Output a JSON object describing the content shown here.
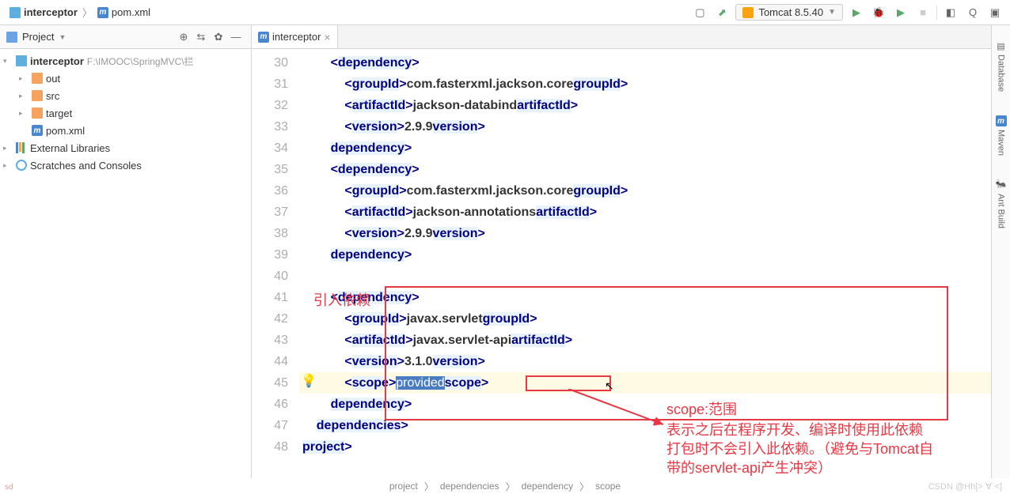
{
  "breadcrumb": {
    "project": "interceptor",
    "file": "pom.xml"
  },
  "runConfig": {
    "label": "Tomcat 8.5.40"
  },
  "projectPanel": {
    "title": "Project",
    "root": {
      "name": "interceptor",
      "path": "F:\\IMOOC\\SpringMVC\\拦"
    },
    "folders": [
      "out",
      "src",
      "target"
    ],
    "file": "pom.xml",
    "ext1": "External Libraries",
    "ext2": "Scratches and Consoles"
  },
  "tab": {
    "label": "interceptor"
  },
  "lines": [
    "30",
    "31",
    "32",
    "33",
    "34",
    "35",
    "36",
    "37",
    "38",
    "39",
    "40",
    "41",
    "42",
    "43",
    "44",
    "45",
    "46",
    "47",
    "48"
  ],
  "code": {
    "l30": {
      "pre": "        <",
      "t1": "dependency",
      "post": ">"
    },
    "l31": {
      "pre": "            <",
      "t1": "groupId",
      "mid": ">",
      "txt": "com.fasterxml.jackson.core",
      "close": "</",
      "t2": "groupId",
      "end": ">"
    },
    "l32": {
      "pre": "            <",
      "t1": "artifactId",
      "mid": ">",
      "txt": "jackson-databind",
      "close": "</",
      "t2": "artifactId",
      "end": ">"
    },
    "l33": {
      "pre": "            <",
      "t1": "version",
      "mid": ">",
      "txt": "2.9.9",
      "close": "</",
      "t2": "version",
      "end": ">"
    },
    "l34": {
      "pre": "        </",
      "t1": "dependency",
      "post": ">"
    },
    "l35": {
      "pre": "        <",
      "t1": "dependency",
      "post": ">"
    },
    "l36": {
      "pre": "            <",
      "t1": "groupId",
      "mid": ">",
      "txt": "com.fasterxml.jackson.core",
      "close": "</",
      "t2": "groupId",
      "end": ">"
    },
    "l37": {
      "pre": "            <",
      "t1": "artifactId",
      "mid": ">",
      "txt": "jackson-annotations",
      "close": "</",
      "t2": "artifactId",
      "end": ">"
    },
    "l38": {
      "pre": "            <",
      "t1": "version",
      "mid": ">",
      "txt": "2.9.9",
      "close": "</",
      "t2": "version",
      "end": ">"
    },
    "l39": {
      "pre": "        </",
      "t1": "dependency",
      "post": ">"
    },
    "l40": "",
    "l41": {
      "pre": "        <",
      "t1": "dependency",
      "post": ">"
    },
    "l42": {
      "pre": "            <",
      "t1": "groupId",
      "mid": ">",
      "txt": "javax.servlet",
      "close": "</",
      "t2": "groupId",
      "end": ">"
    },
    "l43": {
      "pre": "            <",
      "t1": "artifactId",
      "mid": ">",
      "txt": "javax.servlet-api",
      "close": "</",
      "t2": "artifactId",
      "end": ">"
    },
    "l44": {
      "pre": "            <",
      "t1": "version",
      "mid": ">",
      "txt": "3.1.0",
      "close": "</",
      "t2": "version",
      "end": ">"
    },
    "l45": {
      "pre": "            <",
      "t1": "scope",
      "mid": ">",
      "txt": "provided",
      "close": "</",
      "t2": "scope",
      "end": ">"
    },
    "l46": {
      "pre": "        </",
      "t1": "dependency",
      "post": ">"
    },
    "l47": {
      "pre": "    </",
      "t1": "dependencies",
      "post": ">"
    },
    "l48": {
      "pre": "</",
      "t1": "project",
      "post": ">"
    }
  },
  "annotations": {
    "intro": "引入依赖",
    "scope": "scope:范围",
    "note1": "表示之后在程序开发、编译时使用此依赖",
    "note2": "打包时不会引入此依赖。（避免与Tomcat自",
    "note3": "带的servlet-api产生冲突）"
  },
  "bottomPath": {
    "a": "project",
    "b": "dependencies",
    "c": "dependency",
    "d": "scope"
  },
  "rightStrip": {
    "db": "Database",
    "mv": "Maven",
    "ant": "Ant Build"
  },
  "watermark": "CSDN @Hh[>˙∀˙<]",
  "sd": "sd"
}
